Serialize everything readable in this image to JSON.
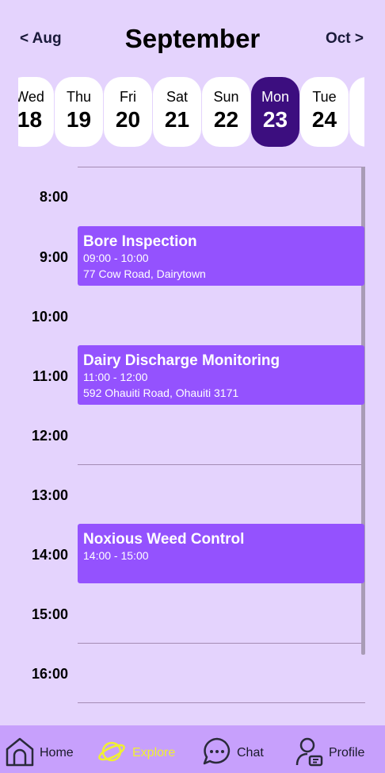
{
  "header": {
    "prev_month": "< Aug",
    "title": "September",
    "next_month": "Oct >"
  },
  "days": [
    {
      "name": "Wed",
      "num": "18",
      "selected": false
    },
    {
      "name": "Thu",
      "num": "19",
      "selected": false
    },
    {
      "name": "Fri",
      "num": "20",
      "selected": false
    },
    {
      "name": "Sat",
      "num": "21",
      "selected": false
    },
    {
      "name": "Sun",
      "num": "22",
      "selected": false
    },
    {
      "name": "Mon",
      "num": "23",
      "selected": true
    },
    {
      "name": "Tue",
      "num": "24",
      "selected": false
    }
  ],
  "hours": [
    "8:00",
    "9:00",
    "10:00",
    "11:00",
    "12:00",
    "13:00",
    "14:00",
    "15:00",
    "16:00"
  ],
  "events": [
    {
      "title": "Bore Inspection",
      "time": "09:00 - 10:00",
      "location": "77 Cow Road, Dairytown"
    },
    {
      "title": "Dairy Discharge Monitoring",
      "time": "11:00 - 12:00",
      "location": "592 Ohauiti Road, Ohauiti 3171"
    },
    {
      "title": "Noxious Weed Control",
      "time": "14:00 - 15:00",
      "location": ""
    }
  ],
  "nav": {
    "home": "Home",
    "explore": "Explore",
    "chat": "Chat",
    "profile": "Profile",
    "active": "explore"
  },
  "colors": {
    "background": "#e4d3fd",
    "selected_day": "#3c0e7f",
    "event": "#9452fe",
    "bottom_nav": "#c7a0fc",
    "active_nav": "#f0f032"
  }
}
